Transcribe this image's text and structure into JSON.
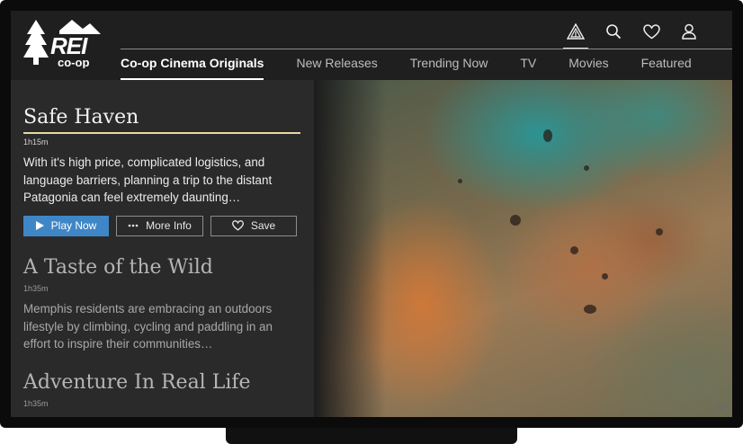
{
  "header": {
    "logo_text": "REI co-op",
    "icons": [
      "mountain-icon",
      "search-icon",
      "heart-icon",
      "user-icon"
    ]
  },
  "nav": {
    "items": [
      {
        "label": "Co-op Cinema Originals",
        "active": true
      },
      {
        "label": "New Releases"
      },
      {
        "label": "Trending Now"
      },
      {
        "label": "TV"
      },
      {
        "label": "Movies"
      },
      {
        "label": "Featured"
      }
    ]
  },
  "films": [
    {
      "title": "Safe Haven",
      "runtime": "1h15m",
      "description": "With it's high price, complicated logistics, and language barriers, planning a trip to the distant Patagonia can feel extremely daunting…",
      "buttons": {
        "play": "Play Now",
        "info": "More Info",
        "save": "Save"
      }
    },
    {
      "title": "A Taste of the Wild",
      "runtime": "1h35m",
      "description": "Memphis residents are embracing an outdoors lifestyle by climbing, cycling and paddling in an effort to inspire their communities…"
    },
    {
      "title": "Adventure In Real Life",
      "runtime": "1h35m"
    }
  ],
  "colors": {
    "accent_blue": "#3f86c7",
    "title_underline": "#e7d9a6",
    "panel_bg": "#2a2a2a"
  }
}
